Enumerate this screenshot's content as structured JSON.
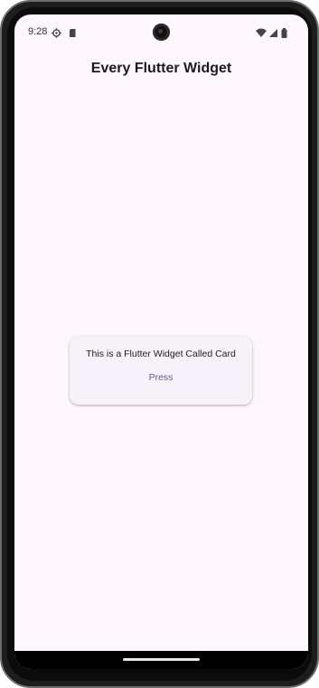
{
  "status_bar": {
    "time": "9:28",
    "left_icons": [
      "settings-gear-icon",
      "sd-card-icon"
    ],
    "right_icons": [
      "wifi-icon",
      "cellular-signal-icon",
      "battery-icon"
    ]
  },
  "app": {
    "title": "Every Flutter Widget"
  },
  "card": {
    "text": "This is a Flutter Widget Called Card",
    "button_label": "Press"
  },
  "colors": {
    "background": "#fdf6fd",
    "card_background": "#f7f2f9",
    "accent": "#65558f",
    "title_text": "#1d1b20"
  }
}
